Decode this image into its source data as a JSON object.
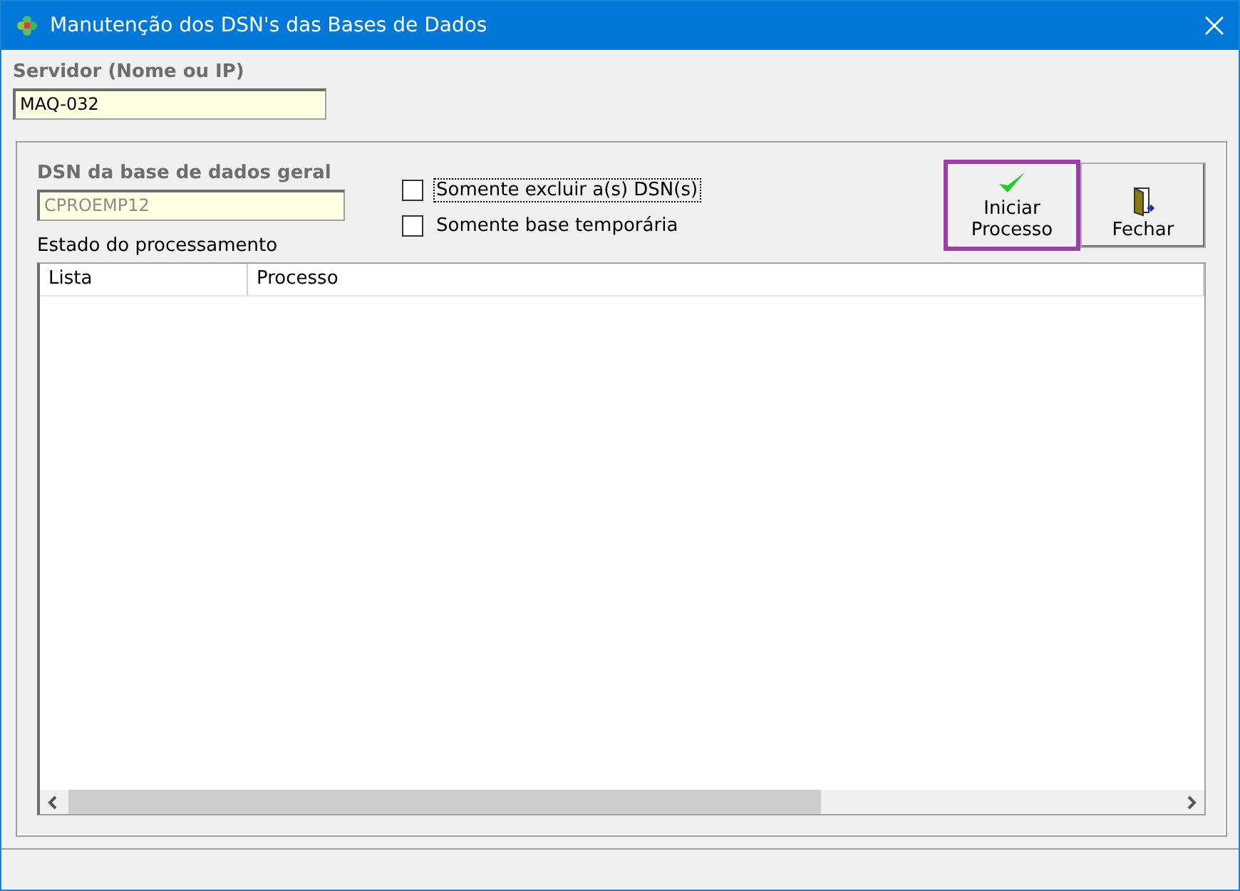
{
  "window": {
    "title": "Manutenção dos DSN's das Bases de Dados"
  },
  "server": {
    "label": "Servidor (Nome ou IP)",
    "value": "MAQ-032"
  },
  "dsn": {
    "label": "DSN da base de dados geral",
    "value": "CPROEMP12"
  },
  "options": [
    {
      "label": "Somente excluir a(s) DSN(s)",
      "checked": false,
      "focused": true
    },
    {
      "label": "Somente base temporária",
      "checked": false,
      "focused": false
    }
  ],
  "buttons": [
    {
      "label": "Iniciar Processo",
      "kind": "start",
      "highlighted": true
    },
    {
      "label": "Fechar",
      "kind": "close",
      "highlighted": false
    }
  ],
  "process_label": "Estado do processamento",
  "table": {
    "columns": [
      "Lista",
      "Processo"
    ]
  }
}
